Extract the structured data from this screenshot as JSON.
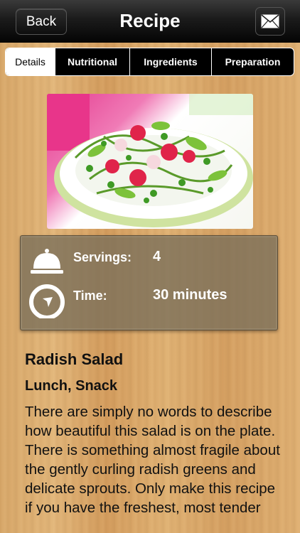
{
  "navbar": {
    "back_label": "Back",
    "title": "Recipe",
    "mail_icon": "envelope-icon"
  },
  "tabs": [
    {
      "label": "Details",
      "active": true
    },
    {
      "label": "Nutritional",
      "active": false
    },
    {
      "label": "Ingredients",
      "active": false
    },
    {
      "label": "Preparation",
      "active": false
    }
  ],
  "info": {
    "servings_label": "Servings:",
    "servings_value": "4",
    "time_label": "Time:",
    "time_value": "30 minutes"
  },
  "recipe": {
    "title": "Radish Salad",
    "category": "Lunch, Snack",
    "description": "There are simply no words to describe how beautiful this salad is on the plate. There is something almost fragile about the gently curling radish greens and delicate sprouts. Only make this recipe if you have the freshest, most tender"
  }
}
